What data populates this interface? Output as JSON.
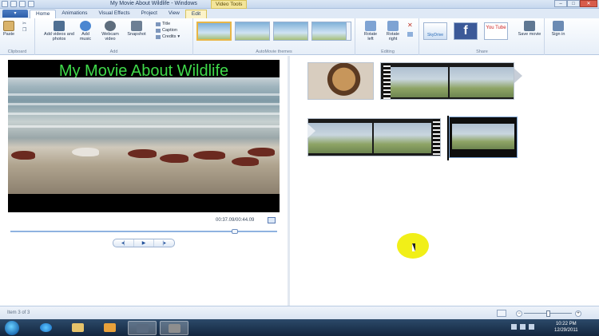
{
  "window": {
    "title": "My Movie About Wildlife - Windows",
    "context_tab_header": "Video Tools",
    "controls": [
      "–",
      "□",
      "✕"
    ]
  },
  "tabs": [
    {
      "label": "Home",
      "active": true
    },
    {
      "label": "Animations",
      "active": false
    },
    {
      "label": "Visual Effects",
      "active": false
    },
    {
      "label": "Project",
      "active": false
    },
    {
      "label": "View",
      "active": false
    },
    {
      "label": "Edit",
      "active": false
    }
  ],
  "ribbon": {
    "clipboard": {
      "paste": "Paste",
      "group_label": "Clipboard"
    },
    "add": {
      "add_videos": "Add videos and photos",
      "add_music": "Add music",
      "webcam": "Webcam video",
      "snapshot": "Snapshot",
      "title": "Title",
      "caption": "Caption",
      "credits": "Credits",
      "group_label": "Add"
    },
    "themes": {
      "group_label": "AutoMovie themes"
    },
    "editing": {
      "rotate_left": "Rotate left",
      "rotate_right": "Rotate right",
      "group_label": "Editing"
    },
    "share": {
      "skydrive": "SkyDrive",
      "facebook": "f",
      "youtube": "You Tube",
      "save_movie": "Save movie",
      "group_label": "Share"
    },
    "signin": {
      "label": "Sign in"
    }
  },
  "preview": {
    "overlay_title": "My Movie About Wildlife",
    "time": "00:37.09/00:44.09",
    "seek_fraction": 0.84
  },
  "playback": {
    "prev": "◂|",
    "play": "▶",
    "next": "|▸"
  },
  "status": {
    "item_text": "Item 3 of 3",
    "zoom_minus": "−",
    "zoom_plus": "+",
    "zoom_fraction": 0.5
  },
  "taskbar": {
    "time": "10:22 PM",
    "date": "12/29/2011"
  },
  "colors": {
    "title_text": "#3fd94a",
    "highlight": "#f1ef18",
    "facebook": "#3b5998",
    "youtube": "#cc2020"
  }
}
